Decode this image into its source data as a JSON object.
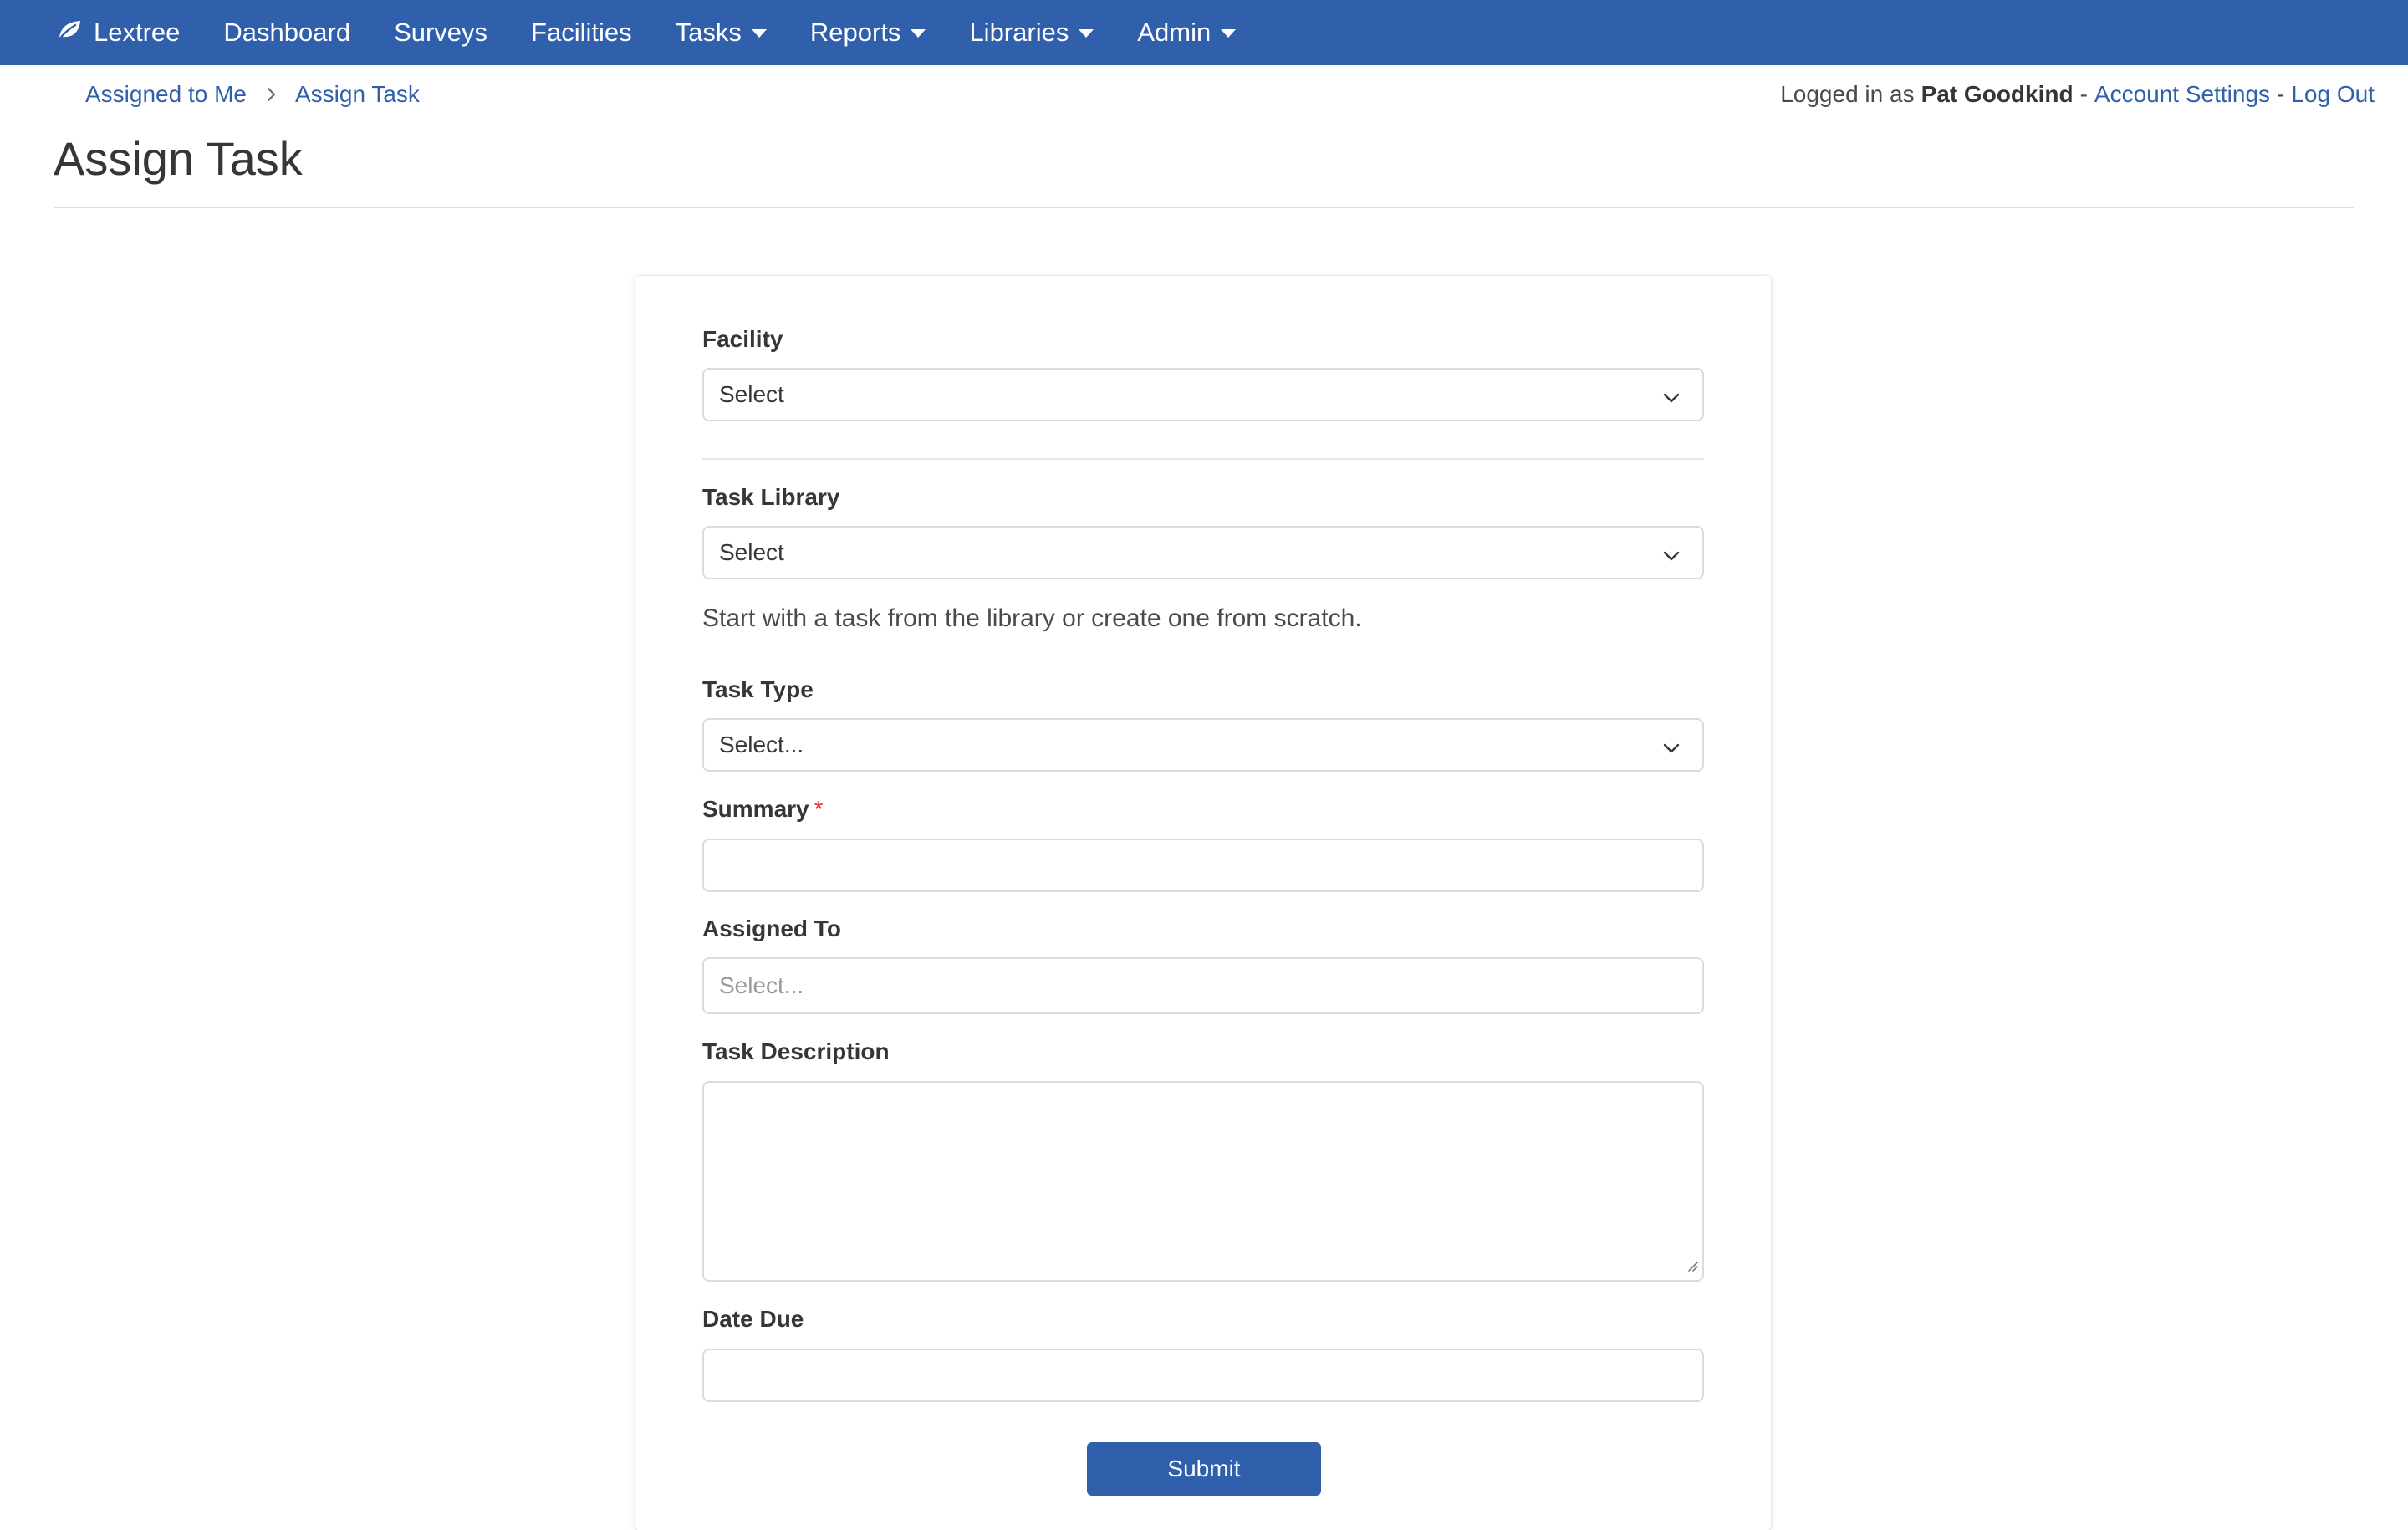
{
  "navbar": {
    "brand": "Lextree",
    "items": [
      {
        "label": "Dashboard"
      },
      {
        "label": "Surveys"
      },
      {
        "label": "Facilities"
      },
      {
        "label": "Tasks"
      },
      {
        "label": "Reports"
      },
      {
        "label": "Libraries"
      },
      {
        "label": "Admin"
      }
    ],
    "background_color": "#3060ac"
  },
  "breadcrumb": {
    "items": [
      {
        "label": "Assigned to Me"
      },
      {
        "label": "Assign Task"
      }
    ]
  },
  "user": {
    "prefix": "Logged in as",
    "name": "Pat Goodkind",
    "account_settings": "Account Settings",
    "log_out": "Log Out",
    "separator": "-"
  },
  "page": {
    "title": "Assign Task"
  },
  "form": {
    "facility": {
      "label": "Facility",
      "value": "Select"
    },
    "task_library": {
      "label": "Task Library",
      "value": "Select",
      "help": "Start with a task from the library or create one from scratch."
    },
    "task_type": {
      "label": "Task Type",
      "value": "Select..."
    },
    "summary": {
      "label": "Summary",
      "required_mark": "*",
      "value": ""
    },
    "assigned_to": {
      "label": "Assigned To",
      "placeholder": "Select..."
    },
    "task_description": {
      "label": "Task Description",
      "value": ""
    },
    "date_due": {
      "label": "Date Due",
      "value": ""
    },
    "submit_label": "Submit"
  },
  "colors": {
    "accent": "#3060ac",
    "required": "#e2302b"
  },
  "icons": {
    "brand": "leaf-icon",
    "dropdown": "caret-down-icon",
    "breadcrumb_separator": "chevron-right-icon",
    "select": "chevron-down-icon",
    "textarea_resize": "resize-grip-icon"
  }
}
